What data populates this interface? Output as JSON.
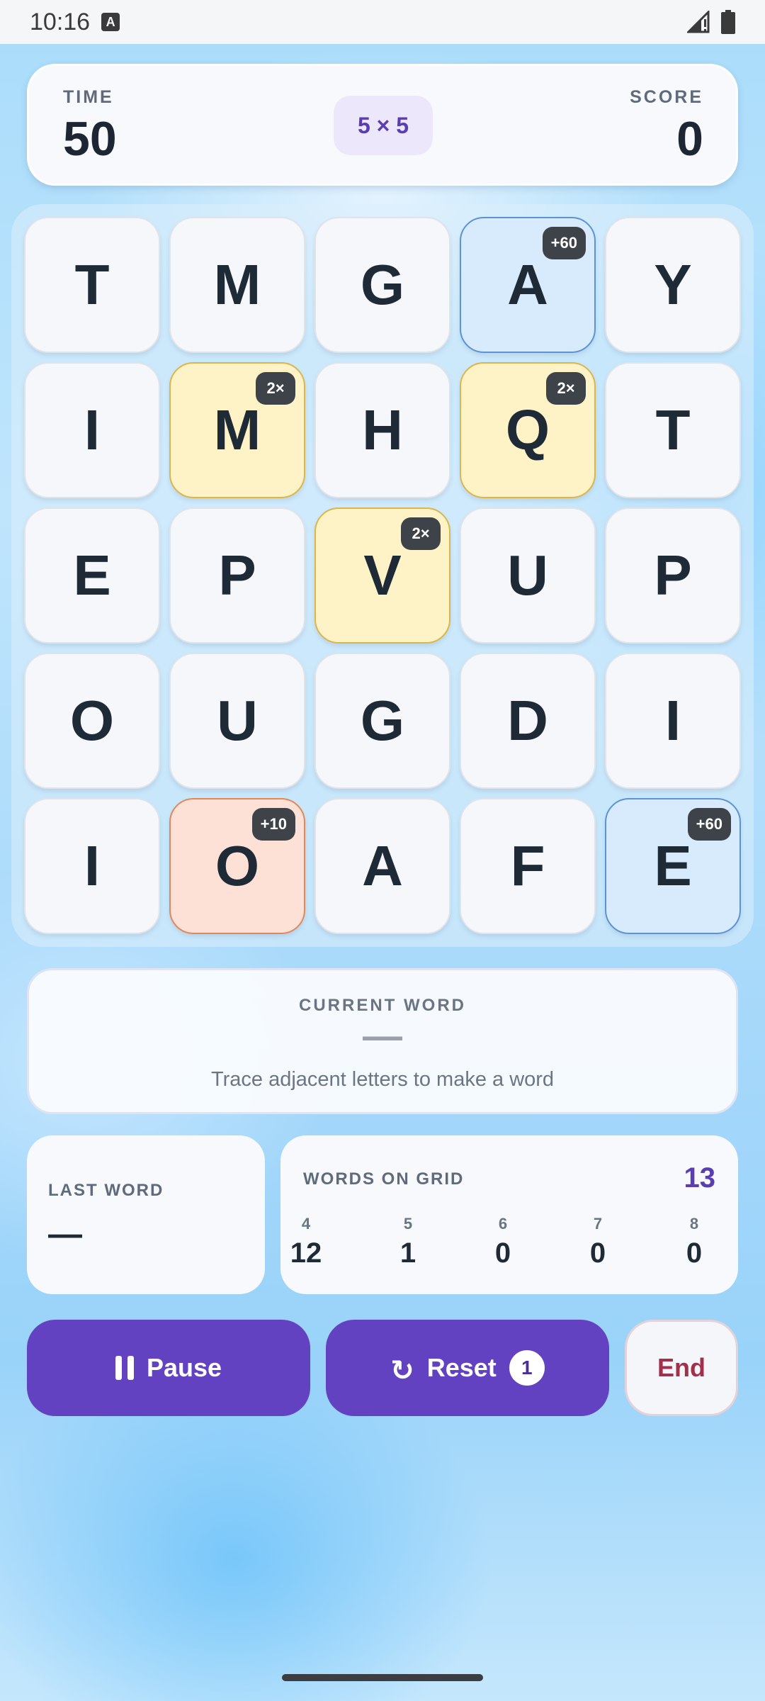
{
  "status_bar": {
    "time": "10:16",
    "notification_icon": "A"
  },
  "header": {
    "time_label": "TIME",
    "time_value": "50",
    "grid_size": "5 × 5",
    "score_label": "SCORE",
    "score_value": "0"
  },
  "board": {
    "tiles": [
      {
        "letter": "T",
        "bonus": "",
        "type": "normal"
      },
      {
        "letter": "M",
        "bonus": "",
        "type": "normal"
      },
      {
        "letter": "G",
        "bonus": "",
        "type": "normal"
      },
      {
        "letter": "A",
        "bonus": "+60",
        "type": "blue"
      },
      {
        "letter": "Y",
        "bonus": "",
        "type": "normal"
      },
      {
        "letter": "I",
        "bonus": "",
        "type": "normal"
      },
      {
        "letter": "M",
        "bonus": "2×",
        "type": "yellow"
      },
      {
        "letter": "H",
        "bonus": "",
        "type": "normal"
      },
      {
        "letter": "Q",
        "bonus": "2×",
        "type": "yellow"
      },
      {
        "letter": "T",
        "bonus": "",
        "type": "normal"
      },
      {
        "letter": "E",
        "bonus": "",
        "type": "normal"
      },
      {
        "letter": "P",
        "bonus": "",
        "type": "normal"
      },
      {
        "letter": "V",
        "bonus": "2×",
        "type": "yellow"
      },
      {
        "letter": "U",
        "bonus": "",
        "type": "normal"
      },
      {
        "letter": "P",
        "bonus": "",
        "type": "normal"
      },
      {
        "letter": "O",
        "bonus": "",
        "type": "normal"
      },
      {
        "letter": "U",
        "bonus": "",
        "type": "normal"
      },
      {
        "letter": "G",
        "bonus": "",
        "type": "normal"
      },
      {
        "letter": "D",
        "bonus": "",
        "type": "normal"
      },
      {
        "letter": "I",
        "bonus": "",
        "type": "normal"
      },
      {
        "letter": "I",
        "bonus": "",
        "type": "normal"
      },
      {
        "letter": "O",
        "bonus": "+10",
        "type": "orange"
      },
      {
        "letter": "A",
        "bonus": "",
        "type": "normal"
      },
      {
        "letter": "F",
        "bonus": "",
        "type": "normal"
      },
      {
        "letter": "E",
        "bonus": "+60",
        "type": "blue"
      }
    ]
  },
  "current_word": {
    "label": "CURRENT WORD",
    "value": "—",
    "hint": "Trace adjacent letters to make a word"
  },
  "last_word": {
    "label": "LAST WORD",
    "value": "—"
  },
  "words_on_grid": {
    "label": "WORDS ON GRID",
    "total": "13",
    "counts": [
      {
        "length": "4",
        "count": "12"
      },
      {
        "length": "5",
        "count": "1"
      },
      {
        "length": "6",
        "count": "0"
      },
      {
        "length": "7",
        "count": "0"
      },
      {
        "length": "8",
        "count": "0"
      }
    ]
  },
  "buttons": {
    "pause_label": "Pause",
    "reset_label": "Reset",
    "reset_count": "1",
    "reset_glyph": "↻",
    "end_label": "End"
  },
  "colors": {
    "accent": "#6342c2",
    "bonus_word_multiplier": "#fdf3c6",
    "bonus_time": "#d8ebfc",
    "bonus_points": "#fde1d6",
    "end_text": "#a2304a"
  }
}
